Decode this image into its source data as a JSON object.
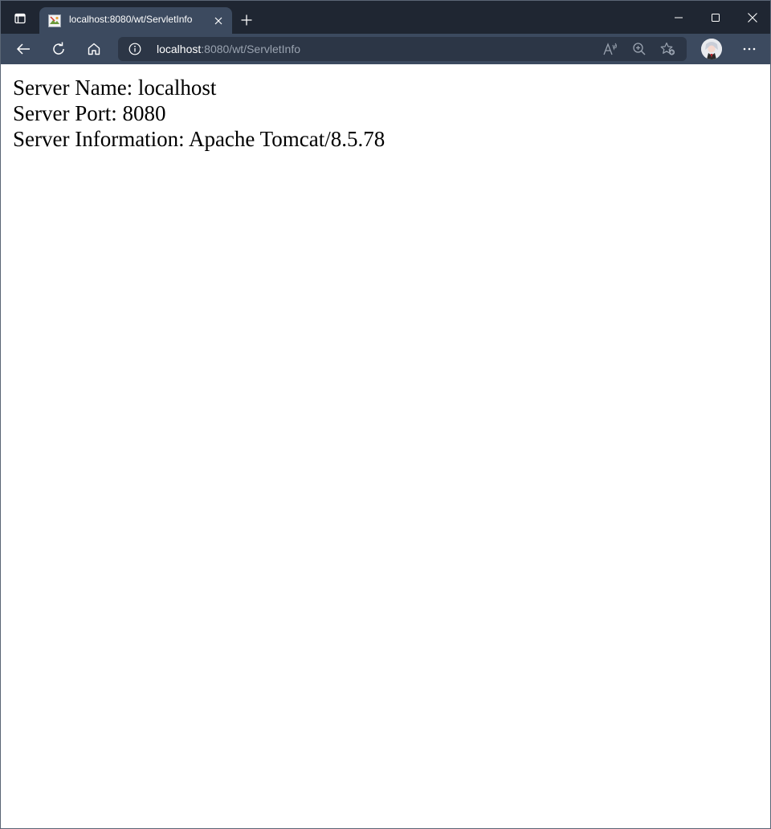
{
  "browser": {
    "tab": {
      "title": "localhost:8080/wt/ServletInfo",
      "favicon_icon": "broken-image-icon"
    },
    "address_bar": {
      "host": "localhost",
      "path": ":8080/wt/ServletInfo"
    },
    "toolbar_icons": [
      "back-arrow-icon",
      "refresh-icon",
      "home-icon",
      "info-icon",
      "read-aloud-icon",
      "zoom-in-icon",
      "add-favorite-icon",
      "profile-avatar",
      "more-icon"
    ],
    "window_controls": [
      "minimize-icon",
      "maximize-icon",
      "close-icon"
    ],
    "colors": {
      "titlebar": "#1f2632",
      "tab_active": "#3c4a5f",
      "toolbar": "#3c4a5f",
      "address_bar": "#2c3646"
    }
  },
  "page": {
    "lines": [
      "Server Name: localhost",
      "Server Port: 8080",
      "Server Information: Apache Tomcat/8.5.78"
    ]
  }
}
